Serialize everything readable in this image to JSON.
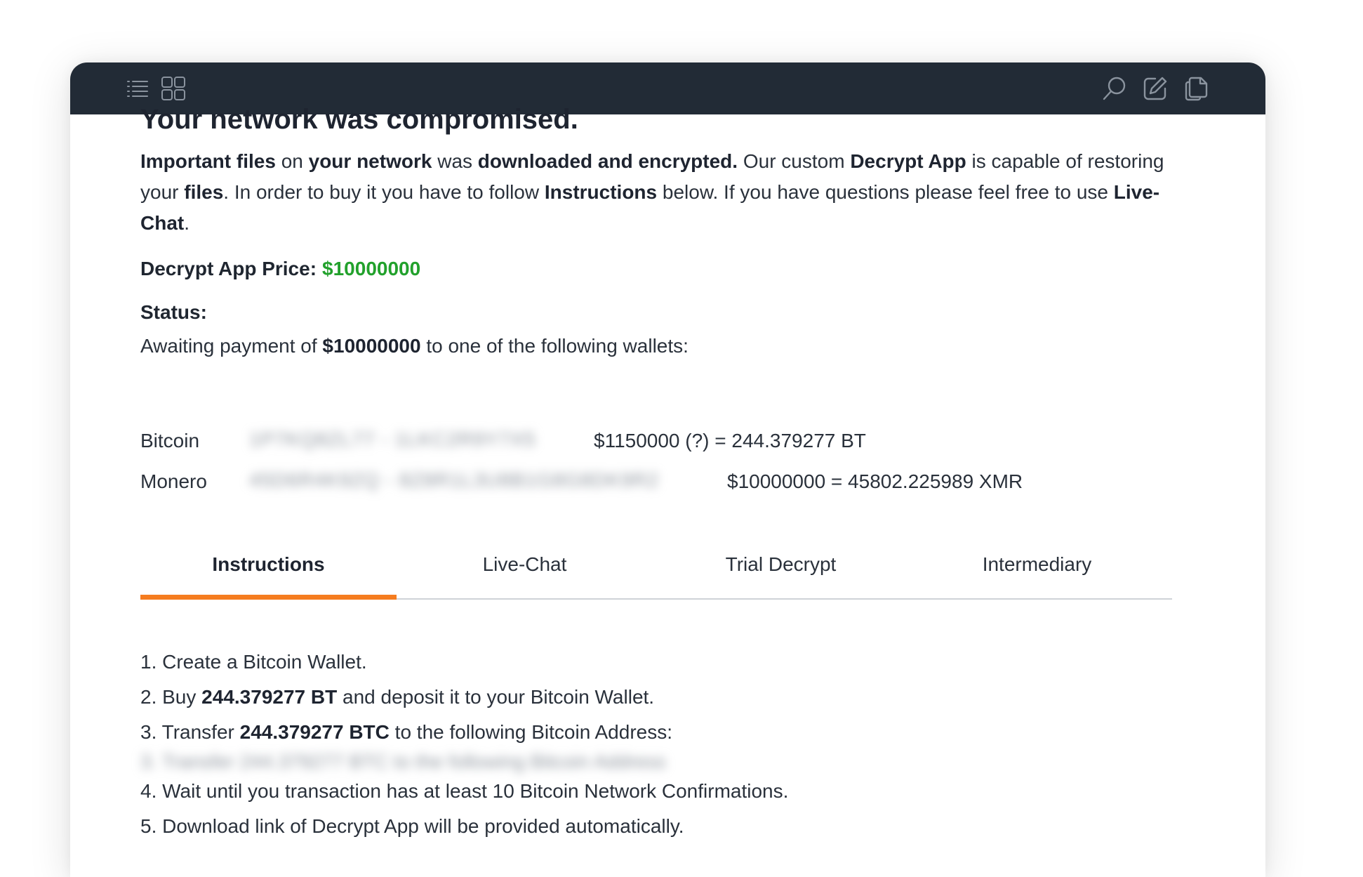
{
  "toolbar": {
    "left_icons": [
      "list-icon",
      "grid-icon"
    ],
    "right_icons": [
      "search-icon",
      "edit-icon",
      "copy-icon"
    ]
  },
  "colors": {
    "titlebar": "#222b36",
    "accent_tab": "#f57c1f",
    "price": "#22a12c"
  },
  "main": {
    "title": "Your network was compromised.",
    "intro": {
      "p1": "Important files",
      "p2": " on ",
      "p3": "your network",
      "p4": " was ",
      "p5": "downloaded and encrypted.",
      "p6": " Our custom ",
      "p7": "Decrypt App",
      "p8": " is capable of restoring your ",
      "p9": "files",
      "p10": ". In order to buy it you have to follow ",
      "p11": "Instructions",
      "p12": " below. If you have questions please feel free to use ",
      "p13": "Live-Chat",
      "p14": "."
    },
    "price_label": "Decrypt App Price:",
    "price_value": "$10000000",
    "status_label": "Status:",
    "awaiting": {
      "pre": "Awaiting payment of ",
      "amount": "$10000000",
      "post": " to one of the following wallets:"
    },
    "wallets": [
      {
        "name": "Bitcoin",
        "address": "1P7KQ8ZL77 - 1LKC2R9Y7X5",
        "amount": "$1150000 (?) = 244.379277 BT"
      },
      {
        "name": "Monero",
        "address": "45D6R4K9ZQ - 8Z8R1L3U8B1G8G8DK9R2",
        "amount": "$10000000 = 45802.225989 XMR"
      }
    ]
  },
  "tabs": [
    {
      "label": "Instructions",
      "active": true
    },
    {
      "label": "Live-Chat",
      "active": false
    },
    {
      "label": "Trial Decrypt",
      "active": false
    },
    {
      "label": "Intermediary",
      "active": false
    }
  ],
  "instructions": {
    "step1": "1. Create a Bitcoin Wallet.",
    "step2": {
      "pre": "2. Buy ",
      "amount": "244.379277 BT",
      "post": " and deposit it to your Bitcoin Wallet."
    },
    "step3": {
      "pre": "3. Transfer ",
      "amount": "244.379277 BTC",
      "post": " to the following Bitcoin Address:"
    },
    "step3_address": "3. Transfer 244.379277 BTC to the following Bitcoin Address",
    "step4": "4. Wait until you transaction has at least 10 Bitcoin Network Confirmations.",
    "step5": "5. Download link of Decrypt App will be provided automatically."
  }
}
